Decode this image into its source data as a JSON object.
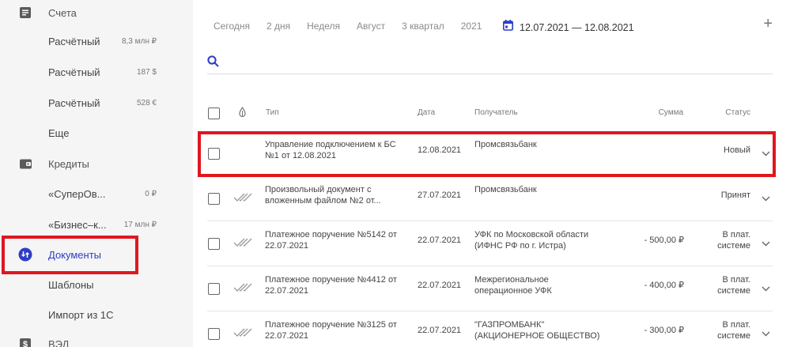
{
  "sidebar": {
    "accounts": {
      "label": "Счета",
      "icon": "accounts-icon"
    },
    "account_items": [
      {
        "label": "Расчётный",
        "amount": "8,3 млн ₽"
      },
      {
        "label": "Расчётный",
        "amount": "187 $"
      },
      {
        "label": "Расчётный",
        "amount": "528 €"
      }
    ],
    "more": "Еще",
    "credits": {
      "label": "Кредиты",
      "icon": "wallet-icon"
    },
    "credit_items": [
      {
        "label": "«СуперОв...",
        "amount": "0 ₽"
      },
      {
        "label": "«Бизнес–к...",
        "amount": "17 млн ₽"
      }
    ],
    "documents": {
      "label": "Документы",
      "icon": "documents-icon"
    },
    "templates": "Шаблоны",
    "import": "Импорт из 1С",
    "ved": {
      "label": "ВЭД",
      "icon": "dollar-icon"
    }
  },
  "filters": {
    "periods": [
      "Сегодня",
      "2 дня",
      "Неделя",
      "Август",
      "3 квартал",
      "2021"
    ],
    "date_range": "12.07.2021 — 12.08.2021"
  },
  "table": {
    "headers": {
      "type": "Тип",
      "date": "Дата",
      "recipient": "Получатель",
      "sum": "Сумма",
      "status": "Статус"
    },
    "rows": [
      {
        "type": "Управление подключением к БС №1 от 12.08.2021",
        "date": "12.08.2021",
        "recipient": "Промсвязьбанк",
        "sum": "",
        "status": "Новый",
        "signed": false
      },
      {
        "type": "Произвольный документ с вложенным файлом №2 от...",
        "date": "27.07.2021",
        "recipient": "Промсвязьбанк",
        "sum": "",
        "status": "Принят",
        "signed": true
      },
      {
        "type": "Платежное поручение №5142 от 22.07.2021",
        "date": "22.07.2021",
        "recipient": "УФК по Московской области (ИФНС РФ по г. Истра)",
        "sum": "- 500,00 ₽",
        "status": "В плат. системе",
        "signed": true
      },
      {
        "type": "Платежное поручение №4412 от 22.07.2021",
        "date": "22.07.2021",
        "recipient": "Межрегиональное операционное УФК",
        "sum": "- 400,00 ₽",
        "status": "В плат. системе",
        "signed": true
      },
      {
        "type": "Платежное поручение №3125 от 22.07.2021",
        "date": "22.07.2021",
        "recipient": "\"ГАЗПРОМБАНК\" (АКЦИОНЕРНОЕ ОБЩЕСТВО)",
        "sum": "- 300,00 ₽",
        "status": "В плат. системе",
        "signed": true
      }
    ]
  },
  "colors": {
    "accent": "#2d3ec5",
    "highlight": "#e0161f",
    "status_pay": "#a32b3b"
  }
}
